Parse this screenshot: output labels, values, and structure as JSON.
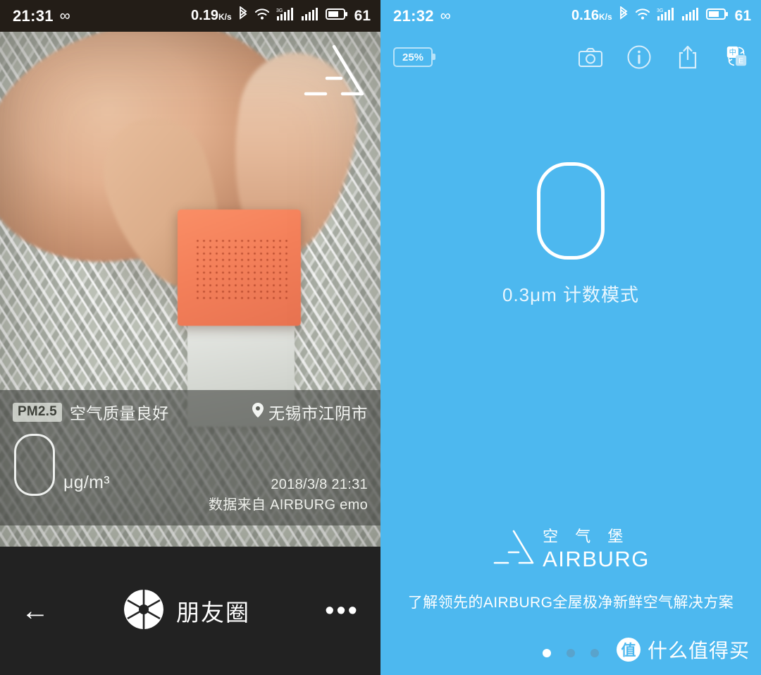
{
  "left": {
    "status_bar": {
      "time": "21:31",
      "infinity_icon": "infinity-icon",
      "network_speed": "0.19",
      "speed_unit": "K/s",
      "bluetooth_icon": "bluetooth-icon",
      "wifi_icon": "wifi-icon",
      "signal1_icon": "signal-3g-icon",
      "signal1_label": "3G",
      "signal2_icon": "signal-icon",
      "battery_icon": "battery-icon",
      "battery_level": "61"
    },
    "photo": {
      "logo_icon": "airburg-triangle-logo"
    },
    "overlay": {
      "pm_badge": "PM2.5",
      "quality_text": "空气质量良好",
      "location_icon": "location-pin-icon",
      "location": "无锡市江阴市",
      "value": "0",
      "unit": "μg/m³",
      "timestamp": "2018/3/8 21:31",
      "source": "数据来自 AIRBURG emo"
    },
    "bottom_bar": {
      "back_icon": "back-arrow-icon",
      "app_icon": "aperture-icon",
      "app_label": "朋友圈",
      "more_icon": "more-dots-icon",
      "more_label": "•••"
    }
  },
  "right": {
    "status_bar": {
      "time": "21:32",
      "infinity_icon": "infinity-icon",
      "network_speed": "0.16",
      "speed_unit": "K/s",
      "bluetooth_icon": "bluetooth-icon",
      "wifi_icon": "wifi-icon",
      "signal1_label": "3G",
      "battery_level": "61"
    },
    "toolbar": {
      "battery_percent": "25%",
      "camera_icon": "camera-icon",
      "info_icon": "info-icon",
      "share_icon": "share-icon",
      "language_icon": "language-toggle-icon",
      "language_cn": "中",
      "language_en": "E"
    },
    "reading": {
      "value": "0",
      "mode_label": "0.3μm 计数模式"
    },
    "brand": {
      "logo_icon": "airburg-triangle-logo",
      "name_cn": "空 气 堡",
      "name_en": "AIRBURG",
      "tagline": "了解领先的AIRBURG全屋极净新鲜空气解决方案"
    },
    "pagination": {
      "total": 3,
      "active_index": 0
    },
    "watermark": {
      "badge_text": "值",
      "text": "什么值得买"
    }
  },
  "colors": {
    "brand_blue": "#4db8ef",
    "status_dark": "#231d17",
    "black_bar": "#222222",
    "device_orange": "#f4805a"
  }
}
